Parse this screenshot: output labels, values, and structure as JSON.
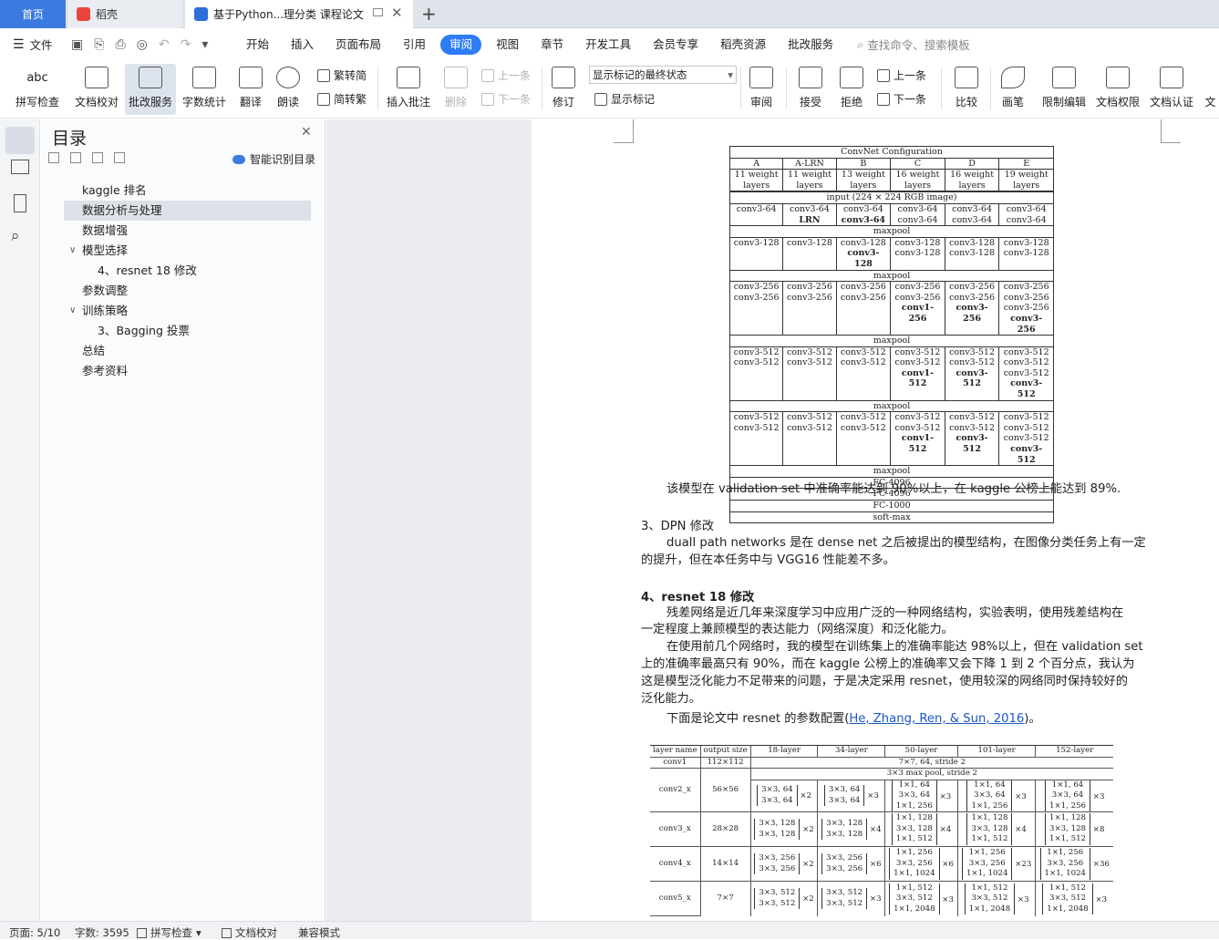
{
  "tabs": {
    "home": "首页",
    "daoke": "稻壳",
    "doc": "基于Python...理分类 课程论文"
  },
  "menubar": {
    "file": "文件",
    "items": [
      "开始",
      "插入",
      "页面布局",
      "引用",
      "审阅",
      "视图",
      "章节",
      "开发工具",
      "会员专享",
      "稻壳资源",
      "批改服务"
    ],
    "active": "审阅",
    "search_placeholder": "查找命令、搜索模板"
  },
  "ribbon": {
    "spell": "拼写检查",
    "proof": "文档校对",
    "review_service": "批改服务",
    "word_count": "字数统计",
    "translate": "翻译",
    "read_aloud": "朗读",
    "trad_simp": "繁转简",
    "simp_trad": "简转繁",
    "insert_comment": "插入批注",
    "delete": "删除",
    "prev": "上一条",
    "next": "下一条",
    "track": "修订",
    "display_state": "显示标记的最终状态",
    "show_marks": "显示标记",
    "review": "审阅",
    "accept": "接受",
    "reject": "拒绝",
    "prev2": "上一条",
    "next2": "下一条",
    "compare": "比较",
    "pen": "画笔",
    "restrict": "限制编辑",
    "rights": "文档权限",
    "certify": "文档认证",
    "more": "文"
  },
  "toc": {
    "title": "目录",
    "smart": "智能识别目录",
    "items": [
      "kaggle 排名",
      "数据分析与处理",
      "数据增强",
      "模型选择",
      "4、resnet 18 修改",
      "参数调整",
      "训练策略",
      "3、Bagging 投票",
      "总结",
      "参考资料"
    ]
  },
  "doc": {
    "vgg": {
      "title": "ConvNet Configuration",
      "cols": [
        "A",
        "A-LRN",
        "B",
        "C",
        "D",
        "E"
      ],
      "layers": [
        "11 weight layers",
        "11 weight layers",
        "13 weight layers",
        "16 weight layers",
        "16 weight layers",
        "19 weight layers"
      ],
      "input": "input (224 × 224 RGB image)",
      "maxpool": "maxpool",
      "fc1": "FC-4096",
      "fc2": "FC-4096",
      "fc3": "FC-1000",
      "softmax": "soft-max"
    },
    "p1": "该模型在 validation set 中准确率能达到 90%以上，在 kaggle 公榜上能达到 89%.",
    "h_dpn": "3、DPN 修改",
    "p2a": "duall path networks 是在 dense net 之后被提出的模型结构，在图像分类任务上有一定",
    "p2b": "的提升，但在本任务中与 VGG16 性能差不多。",
    "h_resnet": "4、resnet 18 修改",
    "p3a": "残差网络是近几年来深度学习中应用广泛的一种网络结构，实验表明，使用残差结构在",
    "p3b": "一定程度上兼顾模型的表达能力（网络深度）和泛化能力。",
    "p4a": "在使用前几个网络时，我的模型在训练集上的准确率能达 98%以上，但在 validation set",
    "p4b": "上的准确率最高只有 90%，而在 kaggle 公榜上的准确率又会下降 1 到 2 个百分点，我认为",
    "p4c": "这是模型泛化能力不足带来的问题，于是决定采用 resnet，使用较深的网络同时保持较好的",
    "p4d": "泛化能力。",
    "p5_pre": "下面是论文中 resnet 的参数配置(",
    "p5_cite": "He, Zhang, Ren, & Sun, 2016",
    "p5_post": ")。",
    "res": {
      "headers": [
        "layer name",
        "output size",
        "18-layer",
        "34-layer",
        "50-layer",
        "101-layer",
        "152-layer"
      ],
      "conv1": "conv1",
      "conv1_size": "112×112",
      "conv1_desc": "7×7, 64, stride 2",
      "pool": "3×3 max pool, stride 2",
      "rows": [
        {
          "name": "conv2_x",
          "size": "56×56"
        },
        {
          "name": "conv3_x",
          "size": "28×28"
        },
        {
          "name": "conv4_x",
          "size": "14×14"
        },
        {
          "name": "conv5_x",
          "size": "7×7"
        }
      ]
    }
  },
  "status": {
    "page": "页面: 5/10",
    "words": "字数: 3595",
    "spell": "拼写检查",
    "proof": "文档校对",
    "compat": "兼容模式"
  }
}
